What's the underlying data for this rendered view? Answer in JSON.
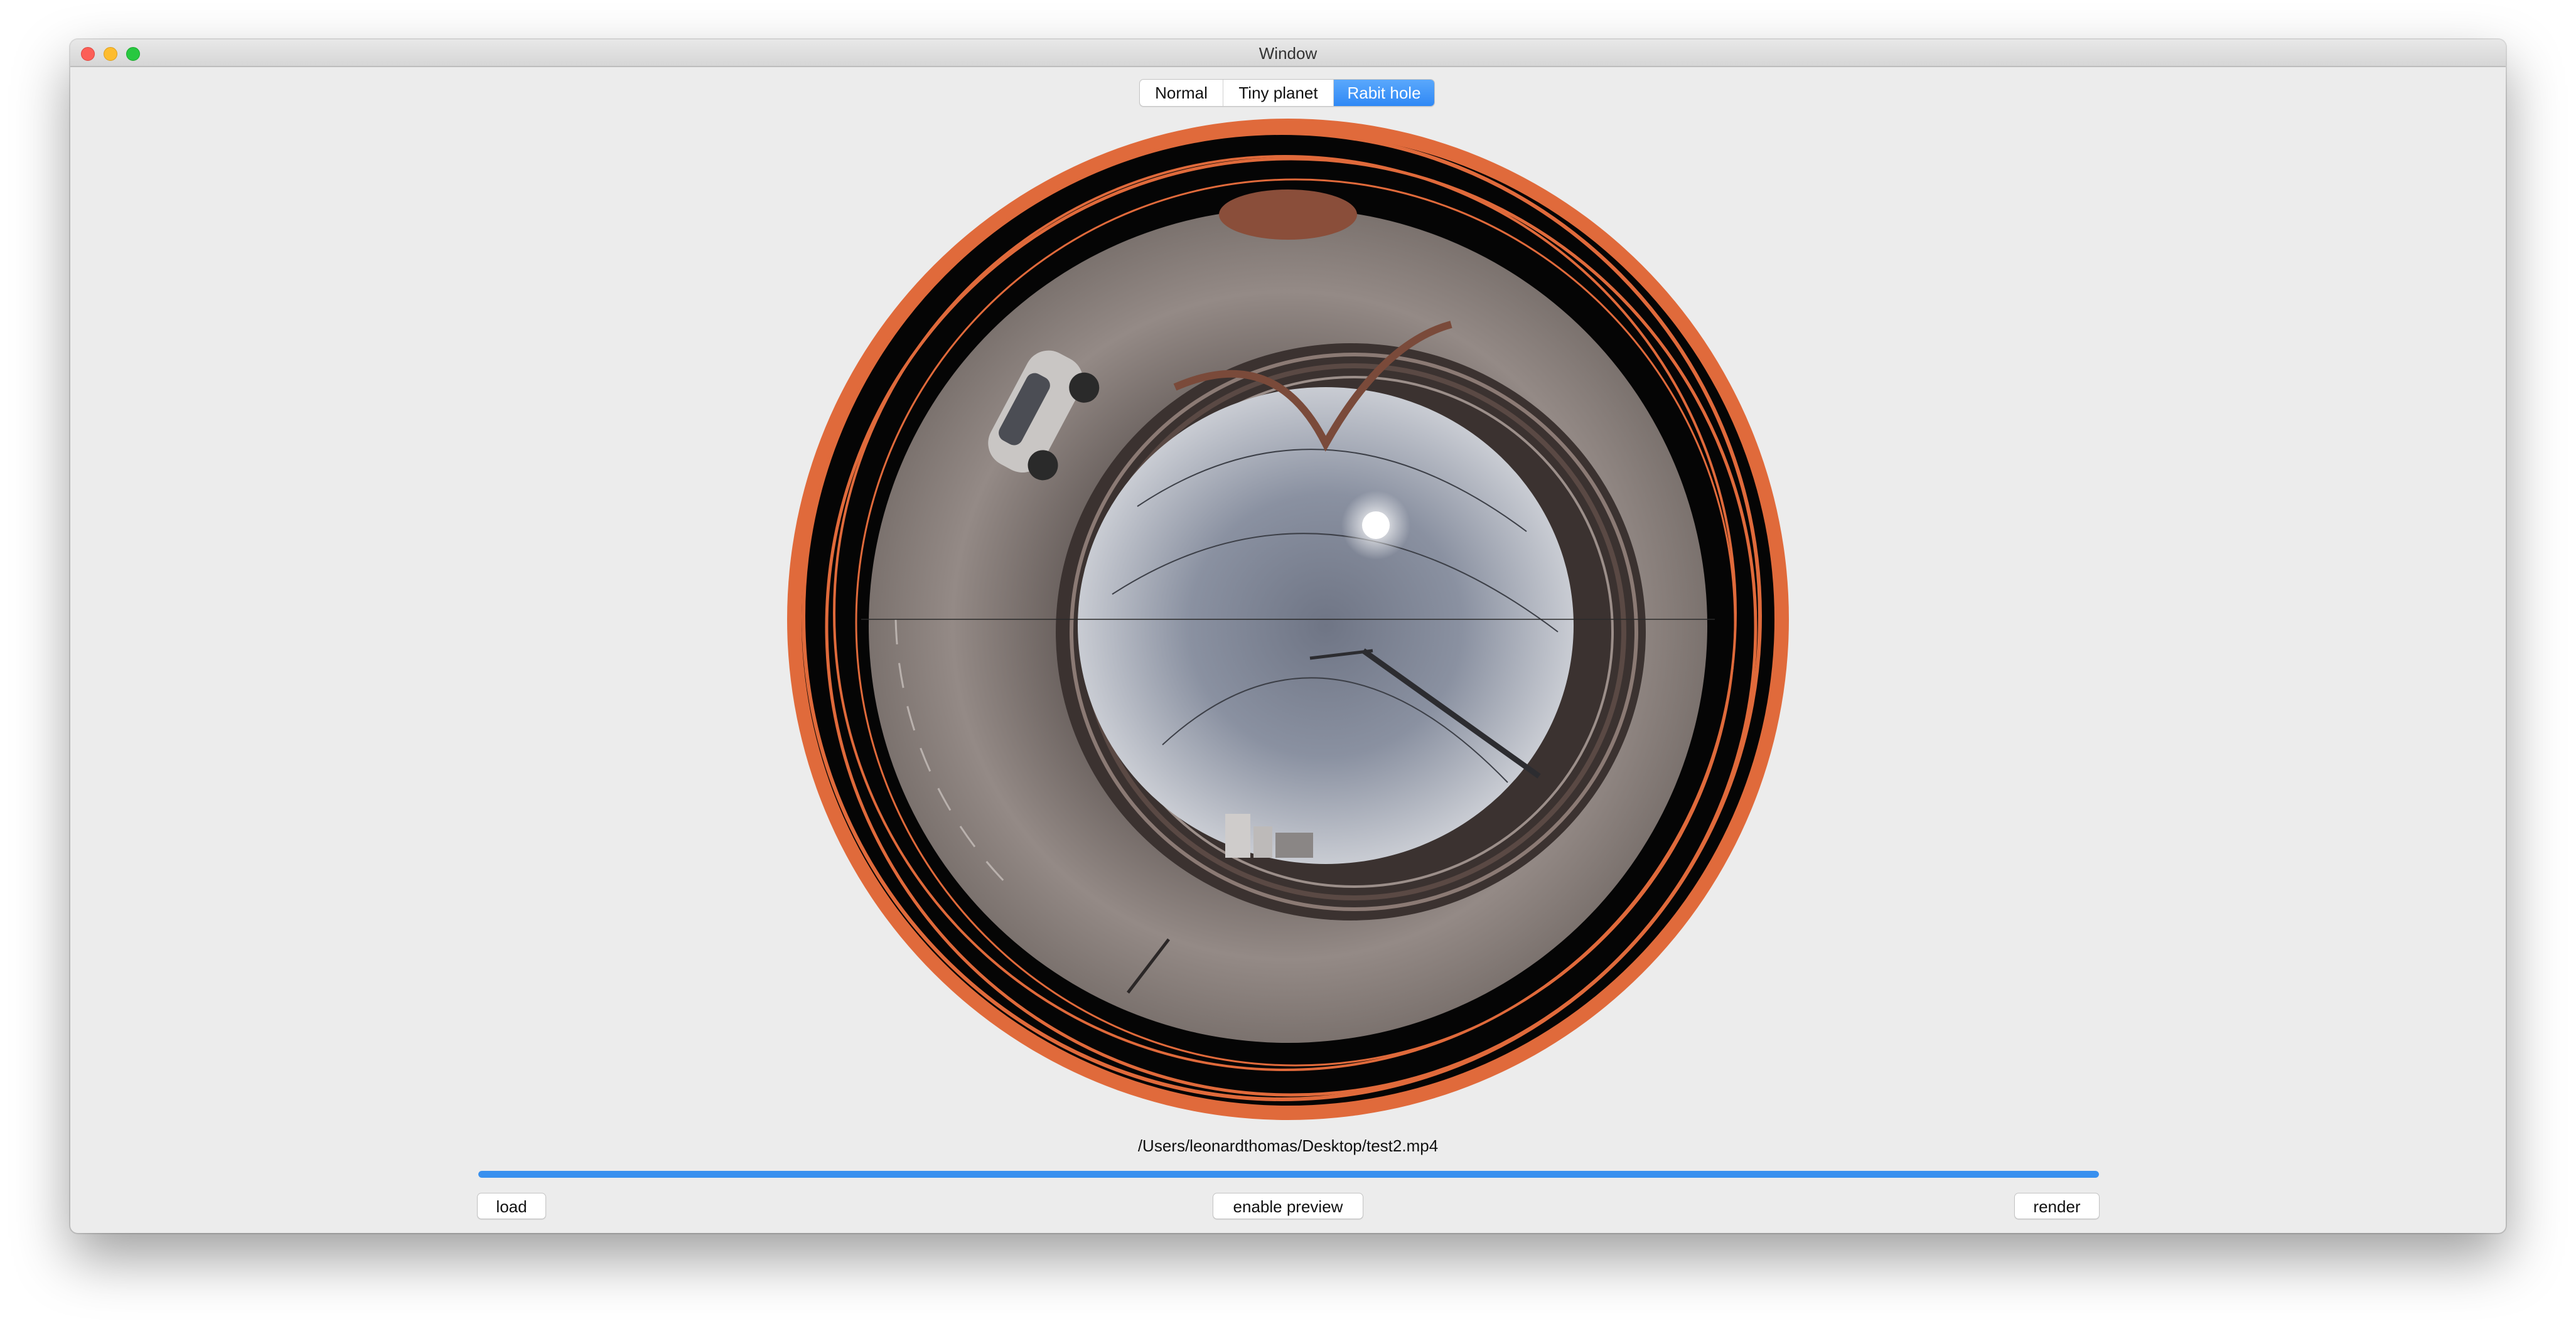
{
  "window": {
    "title": "Window"
  },
  "mode_selector": {
    "options": [
      "Normal",
      "Tiny planet",
      "Rabit hole"
    ],
    "selected": "Rabit hole"
  },
  "preview": {
    "icon": "rabbit-hole-360-video-frame"
  },
  "file": {
    "path": "/Users/leonardthomas/Desktop/test2.mp4"
  },
  "progress": {
    "fraction": 1.0,
    "color": "#3890ef"
  },
  "buttons": {
    "load": "load",
    "enable_preview": "enable preview",
    "render": "render"
  },
  "colors": {
    "accent": "#2f88f5",
    "ring_orange": "#e06a3b",
    "window_bg": "#ececec"
  }
}
